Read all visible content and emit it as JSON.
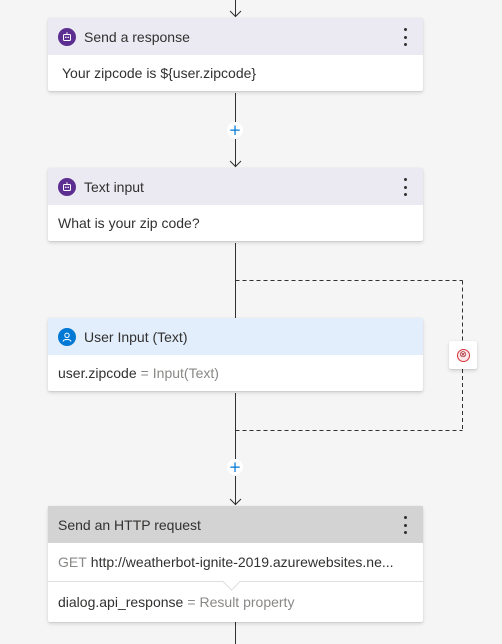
{
  "colors": {
    "canvas_background": "#f5f5f5",
    "bot_header": "#ebe9f1",
    "bot_avatar": "#5c2e91",
    "user_header": "#e2eefb",
    "user_avatar": "#0078d4",
    "http_header": "#d3d3d3",
    "connector": "#323130",
    "add_button": "#0078d4",
    "error": "#d13438"
  },
  "nodes": {
    "send_response": {
      "title": "Send a response",
      "icon": "bot-icon",
      "text": "Your zipcode is ${user.zipcode}"
    },
    "text_input": {
      "title": "Text input",
      "icon": "bot-icon",
      "text": "What is your zip code?"
    },
    "user_input": {
      "title": "User Input (Text)",
      "icon": "user-icon",
      "property": "user.zipcode",
      "equals": "=",
      "value": "Input(Text)"
    },
    "http_request": {
      "title": "Send an HTTP request",
      "method": "GET",
      "url": "http://weatherbot-ignite-2019.azurewebsites.ne...",
      "result_property": "dialog.api_response",
      "equals": "=",
      "result_label": "Result property"
    }
  },
  "add_button_label": "+",
  "error_icon_label": "⊗"
}
